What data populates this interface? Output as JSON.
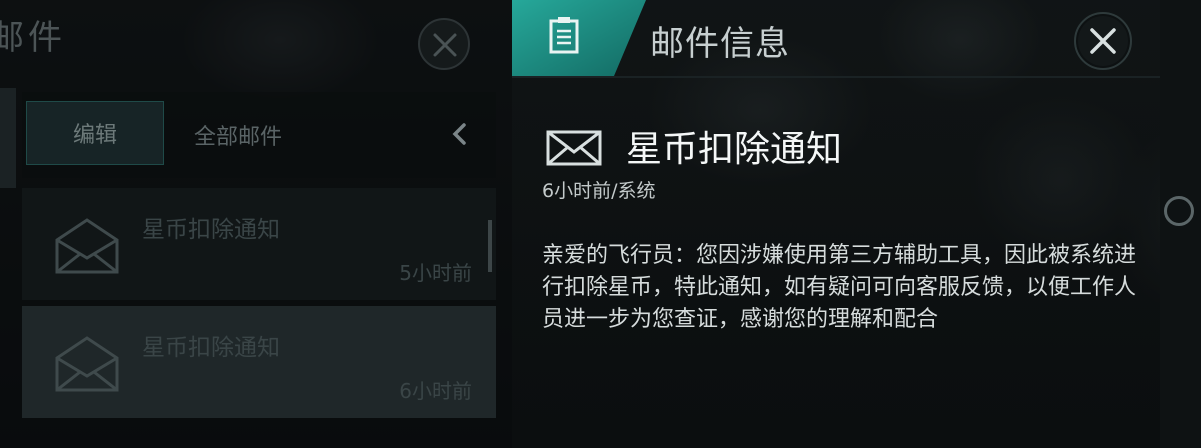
{
  "mailbox": {
    "title": "邮件",
    "edit_label": "编辑",
    "filter_label": "全部邮件",
    "items": [
      {
        "subject": "星币扣除通知",
        "time": "5小时前",
        "selected": false
      },
      {
        "subject": "星币扣除通知",
        "time": "6小时前",
        "selected": true
      }
    ]
  },
  "detail": {
    "title": "邮件信息",
    "subject": "星币扣除通知",
    "meta": "6小时前/系统",
    "body": "亲爱的飞行员：您因涉嫌使用第三方辅助工具，因此被系统进行扣除星币，特此通知，如有疑问可向客服反馈，以便工作人员进一步为您查证，感谢您的理解和配合"
  },
  "icons": {
    "close": "close-icon",
    "collapse": "chevron-left-icon",
    "mail_opened": "envelope-open-icon",
    "mail": "envelope-icon",
    "document": "document-icon"
  },
  "colors": {
    "accent_teal": "#1f8f86",
    "panel_bg": "#0e1213"
  }
}
